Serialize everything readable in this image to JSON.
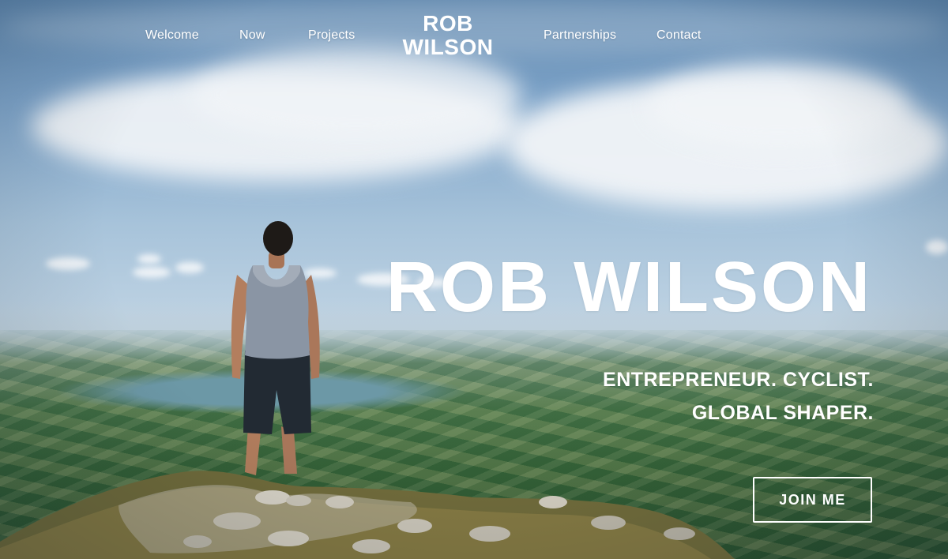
{
  "nav": {
    "items": [
      {
        "label": "Welcome"
      },
      {
        "label": "Now"
      },
      {
        "label": "Projects"
      },
      {
        "label": "Partnerships"
      },
      {
        "label": "Contact"
      }
    ],
    "brand_line1": "ROB",
    "brand_line2": "WILSON"
  },
  "hero": {
    "title": "ROB WILSON",
    "tagline_line1": "ENTREPRENEUR. CYCLIST.",
    "tagline_line2": "GLOBAL SHAPER.",
    "cta_label": "JOIN ME"
  }
}
